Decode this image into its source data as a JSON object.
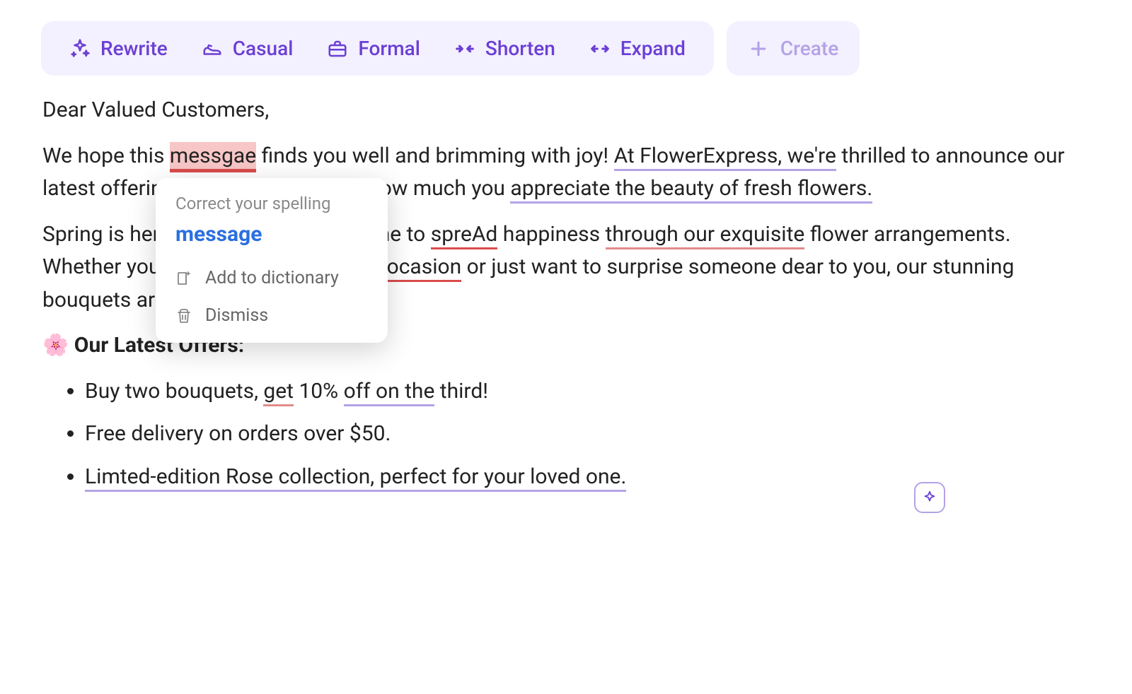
{
  "toolbar": {
    "rewrite": "Rewrite",
    "casual": "Casual",
    "formal": "Formal",
    "shorten": "Shorten",
    "expand": "Expand",
    "create": "Create"
  },
  "doc": {
    "greeting": "Dear Valued Customers,",
    "p1": {
      "t1": "We hope this ",
      "err1": "messgae",
      "t2": " finds you well and brimming with joy! ",
      "u1": "At FlowerExpress, we're",
      "t3": " thrilled to announce our latest offerings, because we know how much you ",
      "u2": "appreciate the beauty of fresh flowers.",
      "t4": ""
    },
    "p2": {
      "t1": "Spring is here, and it's the perfect time to ",
      "e1": "spreAd",
      "t2": " happiness ",
      "e2": "through our exquisite",
      "t3": " flower arrangements. Whether you're celebrating a special ",
      "e3": "ocasion",
      "t4": " or just want to surprise someone dear to you, our stunning bouquets are the ideal choice."
    },
    "offers_heading": "🌸 Our Latest Offers:",
    "offers": {
      "o1": {
        "a": "Buy two bouquets, ",
        "b": "get",
        "c": " 10% ",
        "d": "off on the",
        "e": " third!"
      },
      "o2": "Free delivery on orders over $50.",
      "o3": "Limted-edition Rose collection, perfect for your loved one."
    }
  },
  "popup": {
    "title": "Correct your spelling",
    "suggestion": "message",
    "add": "Add to dictionary",
    "dismiss": "Dismiss"
  }
}
